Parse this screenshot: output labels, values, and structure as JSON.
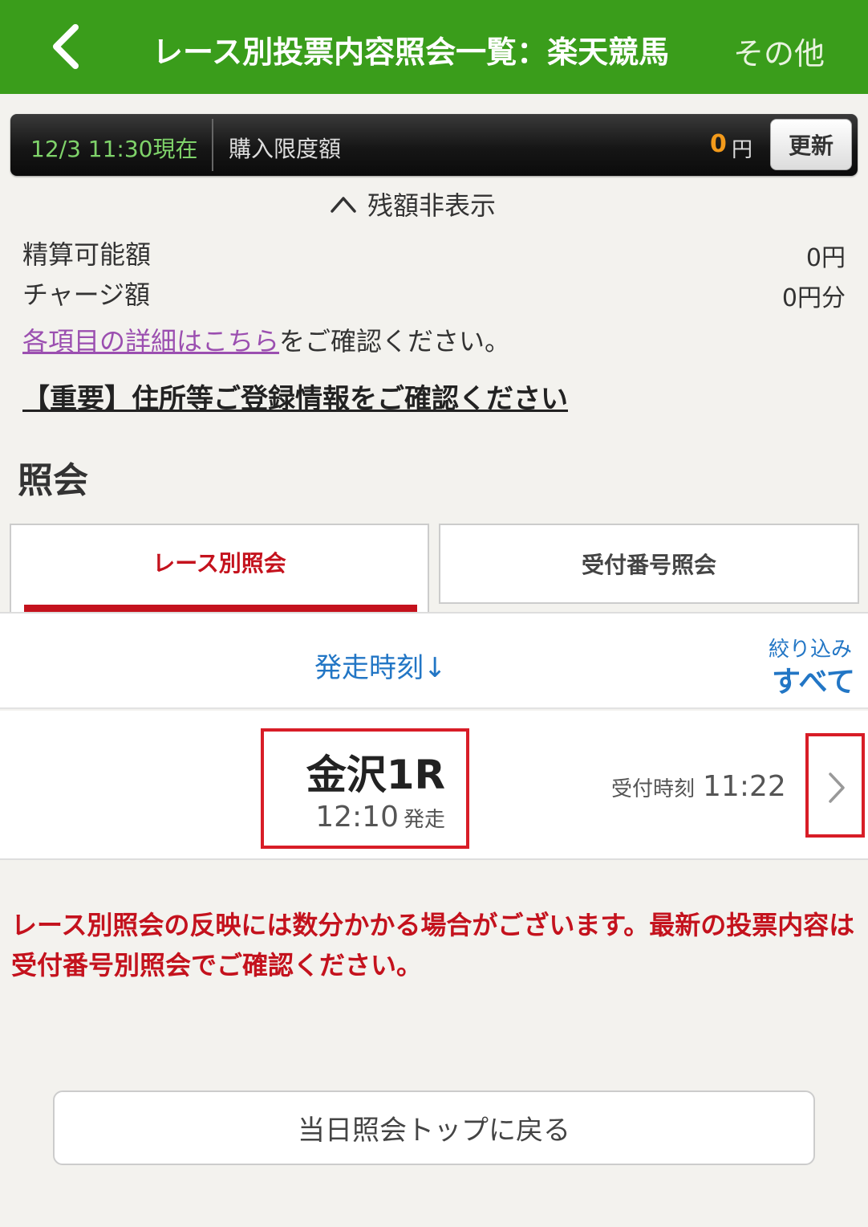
{
  "header": {
    "title": "レース別投票内容照会一覧：楽天競馬",
    "other": "その他"
  },
  "balance_bar": {
    "timestamp": "12/3 11:30現在",
    "label": "購入限度額",
    "amount": "0",
    "currency": "円",
    "refresh_label": "更新"
  },
  "hide_balance_label": "残額非表示",
  "balances": [
    {
      "label": "精算可能額",
      "value": "0円"
    },
    {
      "label": "チャージ額",
      "value": "0円分"
    }
  ],
  "detail": {
    "link_text": "各項目の詳細はこちら",
    "suffix": "をご確認ください。"
  },
  "important_link": "【重要】住所等ご登録情報をご確認ください",
  "section_title": "照会",
  "tabs": [
    {
      "label": "レース別照会",
      "active": true
    },
    {
      "label": "受付番号照会",
      "active": false
    }
  ],
  "sort": {
    "label": "発走時刻↓",
    "filter_label": "絞り込み",
    "filter_value": "すべて"
  },
  "race": {
    "name": "金沢1R",
    "start_time": "12:10",
    "start_suffix": "発走",
    "receipt_label": "受付時刻",
    "receipt_time": "11:22"
  },
  "notice": "レース別照会の反映には数分かかる場合がございます。最新の投票内容は受付番号別照会でご確認ください。",
  "back_to_top_label": "当日照会トップに戻る",
  "colors": {
    "header_green": "#3a9d1b",
    "accent_red": "#c4121d",
    "link_blue": "#2276c5",
    "amount_orange": "#f39a1b",
    "link_purple": "#9b4fb0"
  }
}
